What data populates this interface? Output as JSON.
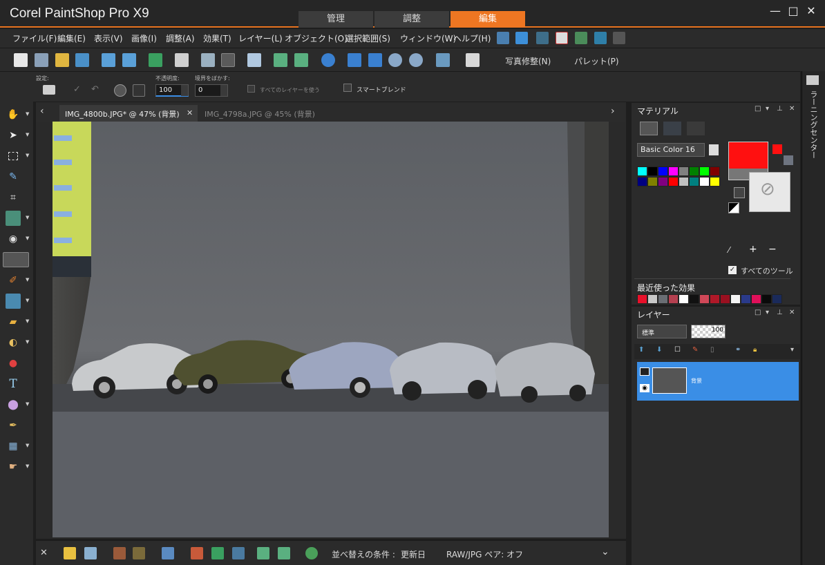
{
  "window": {
    "app_title": "Corel PaintShop Pro X9",
    "workspace_tabs": [
      {
        "label": "管理",
        "active": false
      },
      {
        "label": "調整",
        "active": false
      },
      {
        "label": "編集",
        "active": true
      }
    ],
    "controls": {
      "minimize": "—",
      "maximize": "□",
      "close": "✕"
    }
  },
  "menubar": {
    "items": [
      "ファイル(F)",
      "編集(E)",
      "表示(V)",
      "画像(I)",
      "調整(A)",
      "効果(T)",
      "レイヤー(L)",
      "オブジェクト(O)",
      "選択範囲(S)",
      "ウィンドウ(W)",
      "ヘルプ(H)"
    ]
  },
  "toolbar": {
    "photo_fix_label": "写真修整(N)",
    "palette_label": "パレット(P)"
  },
  "options": {
    "settings_label": "設定:",
    "opacity_label": "不透明度:",
    "opacity_value": "100",
    "feather_label": "境界をぼかす:",
    "feather_value": "0",
    "all_layers_label": "すべてのレイヤーを使う",
    "smart_blend_label": "スマートブレンド"
  },
  "documents": {
    "tabs": [
      {
        "label": "IMG_4800b.JPG* @  47% (背景)",
        "active": true
      },
      {
        "label": "IMG_4798a.JPG @  45% (背景)",
        "active": false
      }
    ],
    "close_glyph": "✕"
  },
  "bottombar": {
    "sort_label": "並べ替えの条件 :",
    "sort_value": "更新日",
    "rawjpg_label": "RAW/JPG ペア: オフ"
  },
  "materials": {
    "title": "マテリアル",
    "palette_select": "Basic Color 16",
    "all_tools_label": "すべてのツール",
    "recent_effects_label": "最近使った効果",
    "foreground_color": "#ff1010",
    "palette_colors": [
      "#00ffff",
      "#000000",
      "#0000ff",
      "#ff00ff",
      "#808080",
      "#008000",
      "#00ff00",
      "#800000",
      "#000080",
      "#808000",
      "#800080",
      "#ff0000",
      "#c0c0c0",
      "#008080",
      "#ffffff",
      "#ffff00"
    ],
    "recent_colors": [
      "#e8102a",
      "#c8c8c8",
      "#6a6e74",
      "#b54050",
      "#ffffff",
      "#111111",
      "#d04858",
      "#b01828",
      "#9a1020",
      "#f4f4f4",
      "#2a3a8a",
      "#e0105a",
      "#0a0a0a",
      "#1a2a5a"
    ]
  },
  "layers": {
    "title": "レイヤー",
    "blend_mode": "標準",
    "opacity": "100",
    "items": [
      {
        "name": "背景"
      }
    ]
  },
  "learning_center": {
    "label": "ラーニングセンター"
  }
}
